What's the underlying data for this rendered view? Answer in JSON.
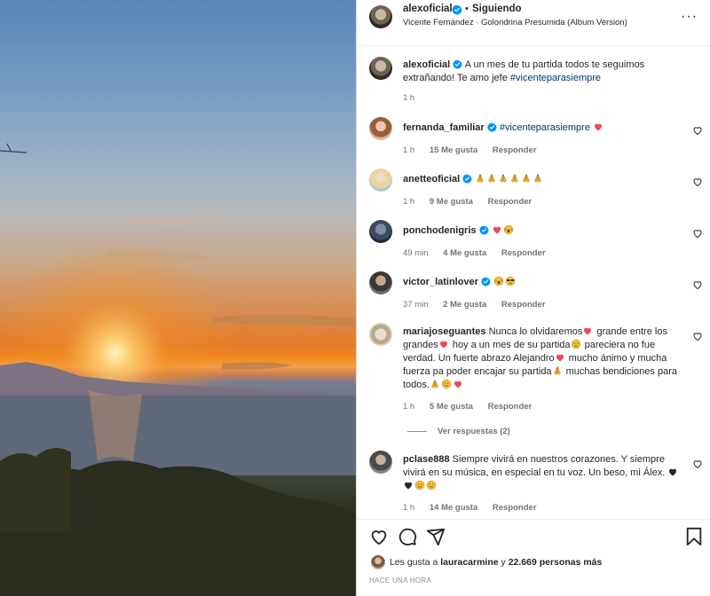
{
  "header": {
    "username": "alexoficial",
    "separator": "•",
    "follow_status": "Siguiendo",
    "song": "Vicente Fernández · Golondrina Presumida (Album Version)",
    "more": "···"
  },
  "caption": {
    "username": "alexoficial",
    "text_before": "A un mes de tu partida todos te seguimos extrañando! Te amo jefe",
    "hashtag": "#vicenteparasiempre",
    "time": "1 h"
  },
  "comments": [
    {
      "username": "fernanda_familiar",
      "text": "#vicenteparasiempre",
      "time": "1 h",
      "likes": "15 Me gusta",
      "reply": "Responder"
    },
    {
      "username": "anetteoficial",
      "time": "1 h",
      "likes": "9 Me gusta",
      "reply": "Responder"
    },
    {
      "username": "ponchodenigris",
      "time": "49 min",
      "likes": "4 Me gusta",
      "reply": "Responder"
    },
    {
      "username": "victor_latinlover",
      "time": "37 min",
      "likes": "2 Me gusta",
      "reply": "Responder"
    },
    {
      "username": "mariajoseguantes",
      "t1": "Nunca lo olvidaremos",
      "t2": "grande entre los grandes",
      "t3": "hoy a un mes de su partida",
      "t4": "pareciera no fue verdad. Un fuerte abrazo Alejandro",
      "t5": "mucho ánimo y mucha fuerza pa poder encajar su partida",
      "t6": "muchas bendiciones para todos.",
      "time": "1 h",
      "likes": "5 Me gusta",
      "reply": "Responder",
      "view_replies": "Ver respuestas (2)"
    },
    {
      "username": "pclase888",
      "text": "Siempre vivirá en nuestros corazones. Y siempre vivirá en su música, en especial en tu voz. Un beso, mi Álex.",
      "time": "1 h",
      "likes": "14 Me gusta",
      "reply": "Responder"
    }
  ],
  "likes_line": {
    "prefix": "Les gusta a",
    "user": "lauracarmine",
    "conj": "y",
    "count": "22.669 personas más"
  },
  "posted_ago": "HACE UNA HORA",
  "colors": {
    "verified": "#0095f6",
    "heart_red": "#ed4956",
    "meta_gray": "#737373",
    "hashtag": "#00376b"
  },
  "icons": [
    "verified-badge-icon",
    "heart-icon",
    "comment-icon",
    "share-icon",
    "bookmark-icon",
    "more-options-icon",
    "pray-emoji-icon",
    "red-heart-emoji-icon",
    "crying-emoji-icon"
  ]
}
